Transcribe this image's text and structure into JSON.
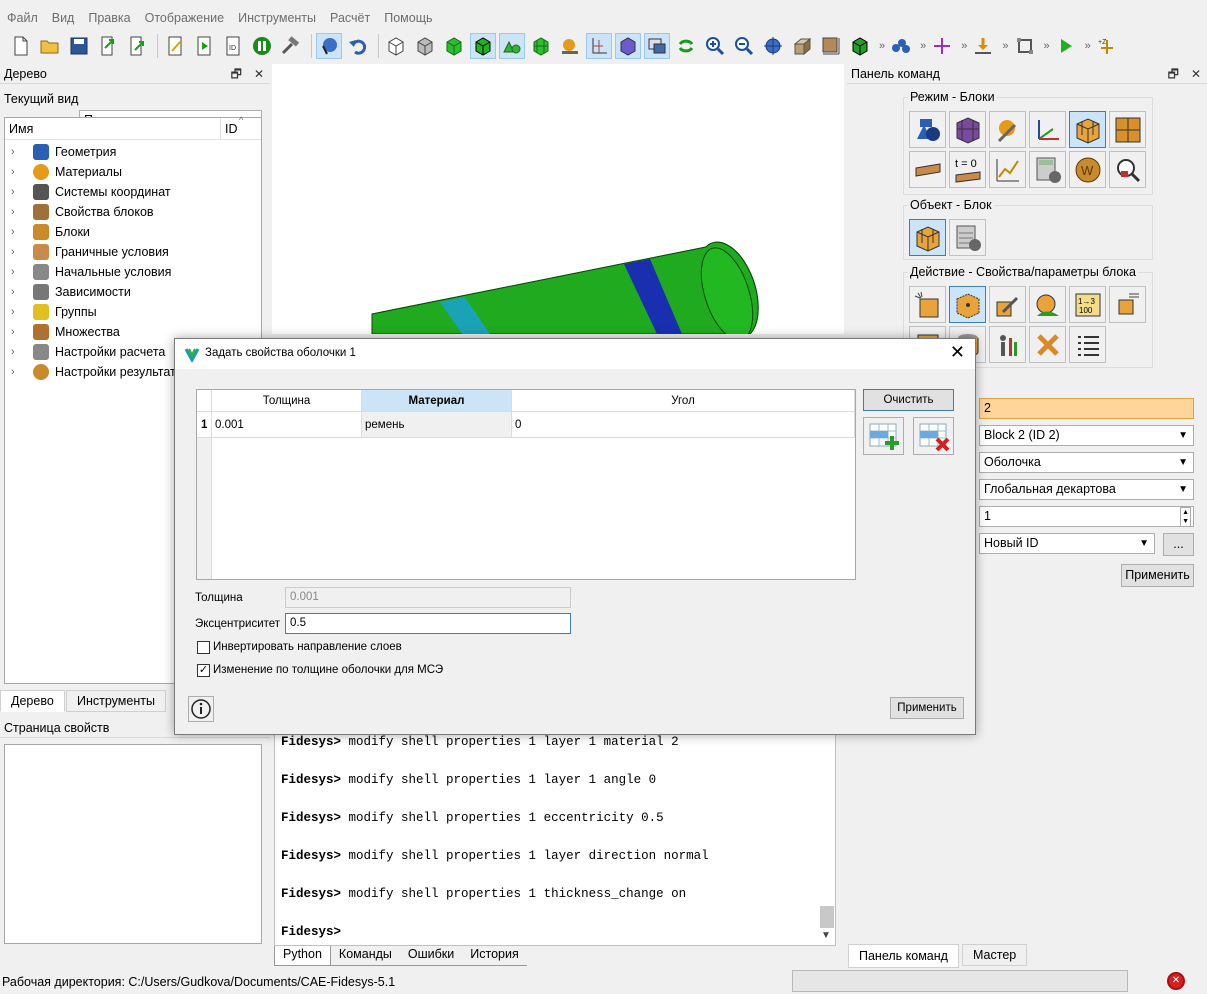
{
  "menu": [
    "Файл",
    "Вид",
    "Правка",
    "Отображение",
    "Инструменты",
    "Расчёт",
    "Помощь"
  ],
  "tree_panel": {
    "title": "Дерево",
    "current_view_label": "Текущий вид",
    "current_view_value": "Полное дерево",
    "col_name": "Имя",
    "col_id": "ID",
    "items": [
      {
        "label": "Геометрия",
        "icon": "geometry-icon"
      },
      {
        "label": "Материалы",
        "icon": "materials-icon"
      },
      {
        "label": "Системы координат",
        "icon": "coordinate-systems-icon"
      },
      {
        "label": "Свойства блоков",
        "icon": "block-properties-icon"
      },
      {
        "label": "Блоки",
        "icon": "blocks-icon"
      },
      {
        "label": "Граничные условия",
        "icon": "boundary-conditions-icon"
      },
      {
        "label": "Начальные условия",
        "icon": "initial-conditions-icon"
      },
      {
        "label": "Зависимости",
        "icon": "dependencies-icon"
      },
      {
        "label": "Группы",
        "icon": "groups-icon"
      },
      {
        "label": "Множества",
        "icon": "sets-icon"
      },
      {
        "label": "Настройки расчета",
        "icon": "analysis-settings-icon"
      },
      {
        "label": "Настройки результатов",
        "icon": "results-settings-icon"
      }
    ],
    "tab_tree": "Дерево",
    "tab_tools": "Инструменты",
    "props_title": "Страница свойств"
  },
  "console": {
    "prompt": "Fidesys>",
    "lines": [
      "modify shell properties 1 layer 1 material 2",
      "modify shell properties 1 layer 1 angle 0",
      "modify shell properties 1 eccentricity 0.5",
      "modify shell properties 1 layer direction normal",
      "modify shell properties 1 thickness_change on",
      ""
    ],
    "tabs": [
      "Python",
      "Команды",
      "Ошибки",
      "История"
    ]
  },
  "cmd_panel": {
    "title": "Панель команд",
    "mode_label": "Режим - Блоки",
    "object_label": "Объект - Блок",
    "action_label": "Действие - Свойства/параметры блока",
    "t0_label": "t = 0",
    "field_id": "2",
    "block_select": "Block 2 (ID 2)",
    "type_select": "Оболочка",
    "cs_select": "Глобальная декартова",
    "spin_value": "1",
    "new_id_select": "Новый ID",
    "more_btn": "...",
    "apply_btn": "Применить",
    "tab_cmd": "Панель команд",
    "tab_master": "Мастер"
  },
  "dialog": {
    "title": "Задать свойства оболочки 1",
    "headers": [
      "Толщина",
      "Материал",
      "Угол"
    ],
    "rows": [
      {
        "num": "1",
        "thickness": "0.001",
        "material": "ремень",
        "angle": "0"
      }
    ],
    "clear_btn": "Очистить",
    "thickness_label": "Толщина",
    "thickness_value": "0.001",
    "eccentricity_label": "Эксцентриситет",
    "eccentricity_value": "0.5",
    "invert_label": "Инвертировать направление слоев",
    "invert_checked": false,
    "change_label": "Изменение по толщине оболочки для МСЭ",
    "change_checked": true,
    "apply_btn": "Применить"
  },
  "status": {
    "workdir": "Рабочая директория: C:/Users/Gudkova/Documents/CAE-Fidesys-5.1"
  },
  "colors": {
    "cylinder": "#1faa1f",
    "cylinder_dark": "#128612",
    "band_cyan": "#1aa3b5",
    "band_blue": "#1a2fb0",
    "active_tool": "#cce4f7"
  }
}
